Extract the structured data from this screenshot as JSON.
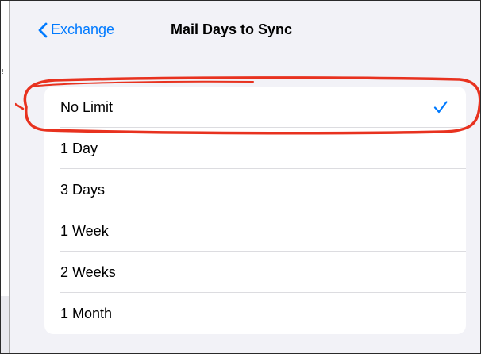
{
  "colors": {
    "accent": "#007aff",
    "highlight": "#e8321f",
    "background": "#f2f2f7"
  },
  "navbar": {
    "back_label": "Exchange",
    "back_icon": "chevron-left-icon",
    "title": "Mail Days to Sync"
  },
  "options": {
    "items": [
      {
        "label": "No Limit",
        "selected": true
      },
      {
        "label": "1 Day",
        "selected": false
      },
      {
        "label": "3 Days",
        "selected": false
      },
      {
        "label": "1 Week",
        "selected": false
      },
      {
        "label": "2 Weeks",
        "selected": false
      },
      {
        "label": "1 Month",
        "selected": false
      }
    ],
    "selected_icon": "checkmark-icon"
  }
}
